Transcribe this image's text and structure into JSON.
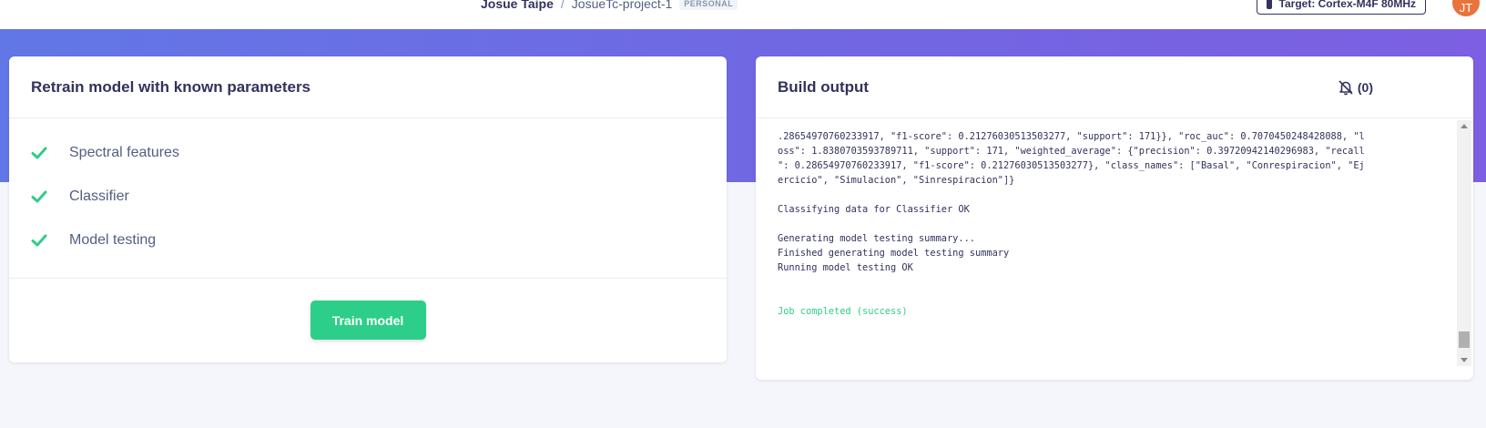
{
  "topbar": {
    "user": "Josue Taipe",
    "separator": "/",
    "project": "JosueTc-project-1",
    "badge": "PERSONAL",
    "target_label": "Target: Cortex-M4F 80MHz",
    "avatar_initials": "JT"
  },
  "colors": {
    "banner_start": "#6277e6",
    "banner_end": "#7c5fe2",
    "accent_green": "#2dce89",
    "avatar": "#e8743b"
  },
  "retrain": {
    "title": "Retrain model with known parameters",
    "steps": [
      {
        "label": "Spectral features",
        "icon": "check-icon"
      },
      {
        "label": "Classifier",
        "icon": "check-icon"
      },
      {
        "label": "Model testing",
        "icon": "check-icon"
      }
    ],
    "button_label": "Train model"
  },
  "build_output": {
    "title": "Build output",
    "notification_count": "(0)",
    "notification_icon": "bell-off-icon",
    "lines": [
      ".28654970760233917, \"f1-score\": 0.21276030513503277, \"support\": 171}}, \"roc_auc\": 0.7070450248428088, \"l",
      "oss\": 1.8380703593789711, \"support\": 171, \"weighted_average\": {\"precision\": 0.39720942140296983, \"recall",
      "\": 0.28654970760233917, \"f1-score\": 0.21276030513503277}, \"class_names\": [\"Basal\", \"Conrespiracion\", \"Ej",
      "ercicio\", \"Simulacion\", \"Sinrespiracion\"]}",
      "",
      "Classifying data for Classifier OK",
      "",
      "Generating model testing summary...",
      "Finished generating model testing summary",
      "Running model testing OK",
      "",
      ""
    ],
    "success_line": "Job completed (success)"
  }
}
